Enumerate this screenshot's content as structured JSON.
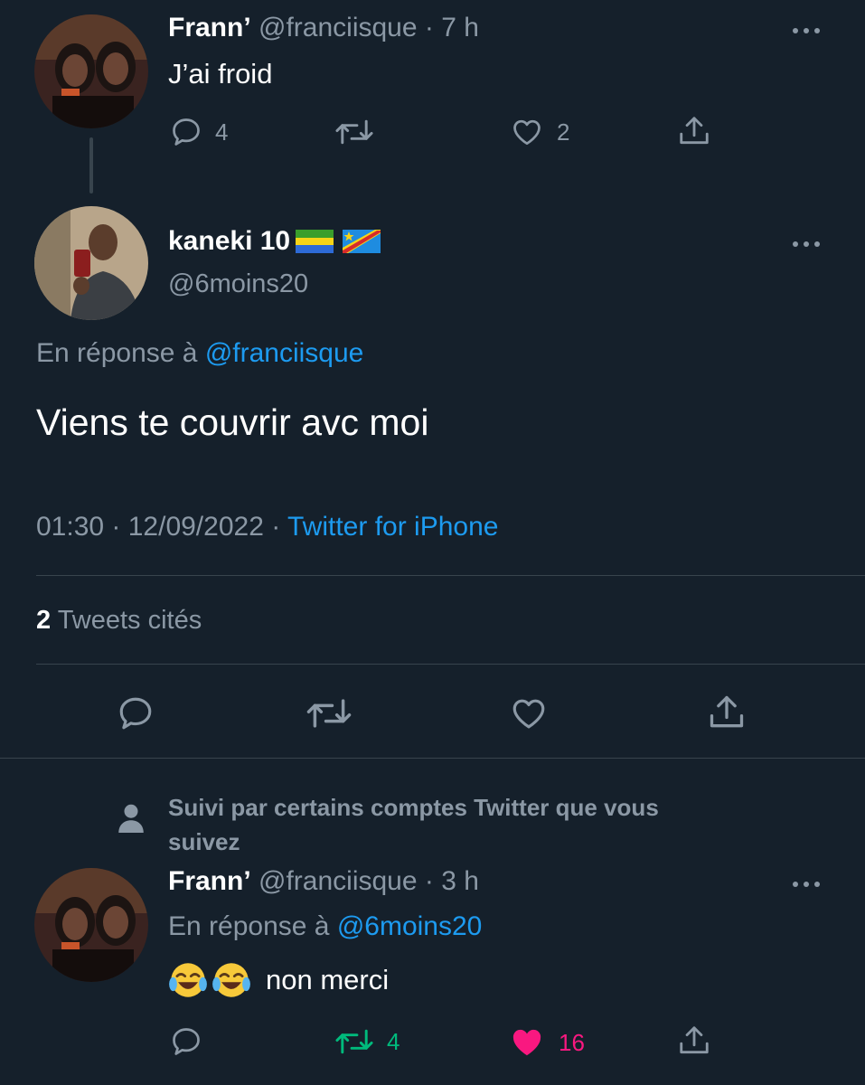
{
  "colors": {
    "background": "#15202b",
    "text": "#ffffff",
    "muted": "#8b98a5",
    "link": "#1d9bf0",
    "retweet_active": "#00ba7c",
    "like_active": "#f91880",
    "divider": "#38444d"
  },
  "parent_tweet": {
    "name": "Frann’",
    "handle": "@franciisque",
    "time": "· 7 h",
    "text": "J’ai froid",
    "actions": {
      "replies": "4",
      "retweets": "",
      "likes": "2"
    }
  },
  "main_tweet": {
    "name": "kaneki 10",
    "flags": [
      "gabon-flag-icon",
      "drc-flag-icon"
    ],
    "handle": "@6moins20",
    "reply_prefix": "En réponse à",
    "reply_to": "@franciisque",
    "text": "Viens te couvrir avc moi",
    "datetime": "01:30 · 12/09/2022 ·",
    "source": "Twitter for iPhone",
    "quote_count": "2",
    "quote_label": "Tweets cités"
  },
  "reply_tweet": {
    "social_context": "Suivi par certains comptes Twitter que vous suivez",
    "name": "Frann’",
    "handle": "@franciisque",
    "time": "· 3 h",
    "reply_prefix": "En réponse à",
    "reply_to": "@6moins20",
    "emoji": [
      "joy-emoji-icon",
      "joy-emoji-icon"
    ],
    "text": "non merci",
    "actions": {
      "replies": "",
      "retweets": "4",
      "likes": "16"
    }
  }
}
